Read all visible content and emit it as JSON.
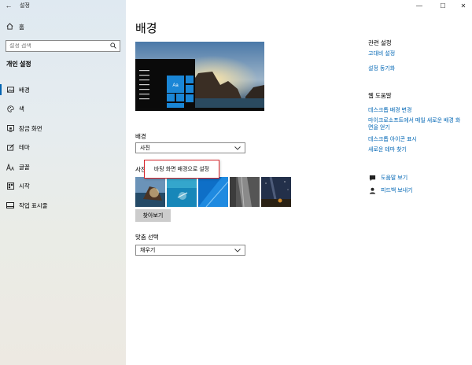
{
  "window": {
    "title": "설정",
    "back_icon": "back-arrow-icon"
  },
  "window_controls": {
    "minimize": "—",
    "maximize": "☐",
    "close": "✕"
  },
  "sidebar": {
    "home_label": "홈",
    "search_placeholder": "설정 검색",
    "section_title": "개인 설정",
    "items": [
      {
        "label": "배경",
        "icon": "picture-icon",
        "active": true
      },
      {
        "label": "색",
        "icon": "palette-icon",
        "active": false
      },
      {
        "label": "잠금 화면",
        "icon": "lock-screen-icon",
        "active": false
      },
      {
        "label": "테마",
        "icon": "theme-icon",
        "active": false
      },
      {
        "label": "글꼴",
        "icon": "font-icon",
        "active": false
      },
      {
        "label": "시작",
        "icon": "start-icon",
        "active": false
      },
      {
        "label": "작업 표시줄",
        "icon": "taskbar-icon",
        "active": false
      }
    ]
  },
  "main": {
    "title": "배경",
    "preview_sample": "Aa",
    "background_label": "배경",
    "background_value": "사진",
    "choose_label_partial": "사진",
    "tooltip_text": "바탕 화면 배경으로 설정",
    "browse_label": "찾아보기",
    "fit_label": "맞춤 선택",
    "fit_value": "채우기"
  },
  "right_panel": {
    "related_title": "관련 설정",
    "related_links": [
      "고대비 설정",
      "설정 동기화"
    ],
    "help_title": "웹 도움말",
    "help_links": [
      "데스크톱 배경 변경",
      "마이크로소프트에서 매일 새로운 배경 화면을 얻기",
      "데스크톱 아이콘 표시",
      "새로운 테마 찾기"
    ],
    "get_help": "도움말 보기",
    "feedback": "피드백 보내기"
  },
  "colors": {
    "accent": "#0063b1",
    "link": "#0066b4",
    "tooltip_border": "#d8242a"
  }
}
